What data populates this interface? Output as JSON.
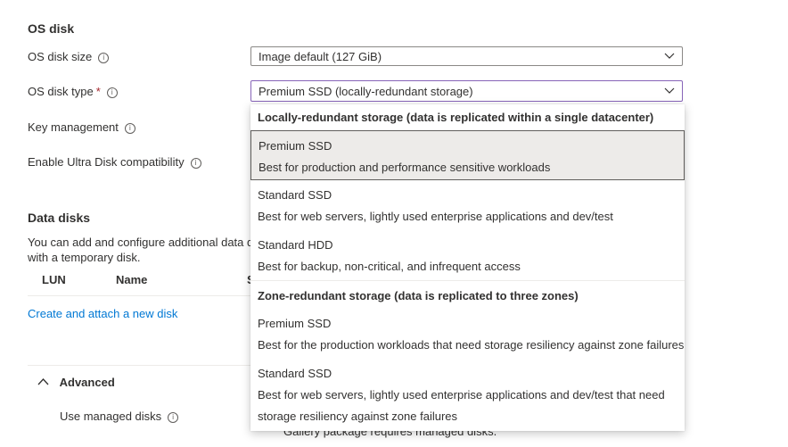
{
  "os_disk": {
    "section_title": "OS disk",
    "size_label": "OS disk size",
    "size_value": "Image default (127 GiB)",
    "type_label": "OS disk type",
    "type_required_mark": "*",
    "type_value": "Premium SSD (locally-redundant storage)",
    "key_management_label": "Key management",
    "ultra_disk_label": "Enable Ultra Disk compatibility"
  },
  "data_disks": {
    "section_title": "Data disks",
    "description_line1": "You can add and configure additional data d",
    "description_line2": "with a temporary disk.",
    "columns": [
      "LUN",
      "Name",
      "S"
    ],
    "create_link": "Create and attach a new disk"
  },
  "advanced": {
    "title": "Advanced",
    "managed_disks_label": "Use managed disks",
    "gallery_note": "Gallery package requires managed disks."
  },
  "dropdown": {
    "groups": [
      {
        "header": "Locally-redundant storage (data is replicated within a single datacenter)",
        "options": [
          {
            "title": "Premium SSD",
            "desc": [
              "Best for production and performance sensitive workloads"
            ],
            "selected": true
          },
          {
            "title": "Standard SSD",
            "desc": [
              "Best for web servers, lightly used enterprise applications and dev/test"
            ],
            "selected": false
          },
          {
            "title": "Standard HDD",
            "desc": [
              "Best for backup, non-critical, and infrequent access"
            ],
            "selected": false
          }
        ]
      },
      {
        "header": "Zone-redundant storage (data is replicated to three zones)",
        "options": [
          {
            "title": "Premium SSD",
            "desc": [
              "Best for the production workloads that need storage resiliency against zone failures"
            ],
            "selected": false
          },
          {
            "title": "Standard SSD",
            "desc": [
              "Best for web servers, lightly used enterprise applications and dev/test that need",
              "storage resiliency against zone failures"
            ],
            "selected": false
          }
        ]
      }
    ]
  },
  "icons": {
    "info": "info-icon",
    "chevron": "chevron-down-icon",
    "collapse": "chevron-up-icon"
  },
  "colors": {
    "accent_link": "#0078d4",
    "focus_border": "#8764b8",
    "required": "#a4262c",
    "selected_bg": "#edebe9"
  }
}
